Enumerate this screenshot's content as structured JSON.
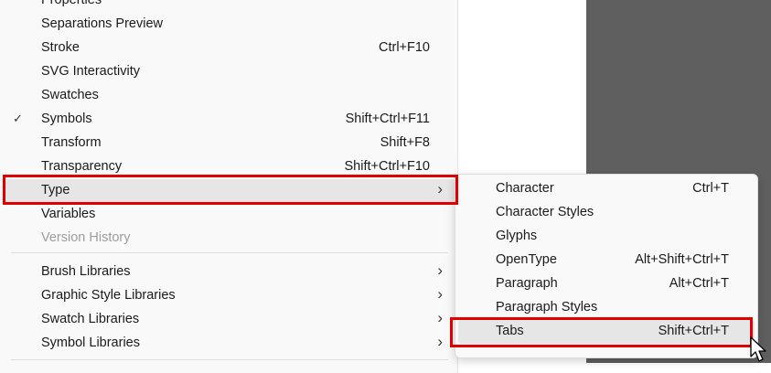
{
  "main_menu": {
    "items": [
      {
        "label": "Properties",
        "shortcut": "",
        "checked": false,
        "submenu": false,
        "disabled": false
      },
      {
        "label": "Separations Preview",
        "shortcut": "",
        "checked": false,
        "submenu": false,
        "disabled": false
      },
      {
        "label": "Stroke",
        "shortcut": "Ctrl+F10",
        "checked": false,
        "submenu": false,
        "disabled": false
      },
      {
        "label": "SVG Interactivity",
        "shortcut": "",
        "checked": false,
        "submenu": false,
        "disabled": false
      },
      {
        "label": "Swatches",
        "shortcut": "",
        "checked": false,
        "submenu": false,
        "disabled": false
      },
      {
        "label": "Symbols",
        "shortcut": "Shift+Ctrl+F11",
        "checked": true,
        "submenu": false,
        "disabled": false
      },
      {
        "label": "Transform",
        "shortcut": "Shift+F8",
        "checked": false,
        "submenu": false,
        "disabled": false
      },
      {
        "label": "Transparency",
        "shortcut": "Shift+Ctrl+F10",
        "checked": false,
        "submenu": false,
        "disabled": false
      },
      {
        "label": "Type",
        "shortcut": "",
        "checked": false,
        "submenu": true,
        "disabled": false,
        "highlighted": true
      },
      {
        "label": "Variables",
        "shortcut": "",
        "checked": false,
        "submenu": false,
        "disabled": false
      },
      {
        "label": "Version History",
        "shortcut": "",
        "checked": false,
        "submenu": false,
        "disabled": true
      }
    ],
    "library_items": [
      {
        "label": "Brush Libraries",
        "submenu": true
      },
      {
        "label": "Graphic Style Libraries",
        "submenu": true
      },
      {
        "label": "Swatch Libraries",
        "submenu": true
      },
      {
        "label": "Symbol Libraries",
        "submenu": true
      }
    ],
    "check_glyph": "✓",
    "arrow_glyph": "›"
  },
  "type_submenu": {
    "items": [
      {
        "label": "Character",
        "shortcut": "Ctrl+T"
      },
      {
        "label": "Character Styles",
        "shortcut": ""
      },
      {
        "label": "Glyphs",
        "shortcut": ""
      },
      {
        "label": "OpenType",
        "shortcut": "Alt+Shift+Ctrl+T"
      },
      {
        "label": "Paragraph",
        "shortcut": "Alt+Ctrl+T"
      },
      {
        "label": "Paragraph Styles",
        "shortcut": ""
      },
      {
        "label": "Tabs",
        "shortcut": "Shift+Ctrl+T",
        "highlighted": true
      }
    ]
  },
  "colors": {
    "highlight_box": "#e00000",
    "menu_bg": "#f9f9f9",
    "hover_bg": "#e6e6e6",
    "canvas_dark": "#5f5f5f"
  },
  "icons": {
    "checkmark": "check-icon",
    "submenu_arrow": "chevron-right-icon",
    "cursor": "mouse-pointer-icon"
  }
}
